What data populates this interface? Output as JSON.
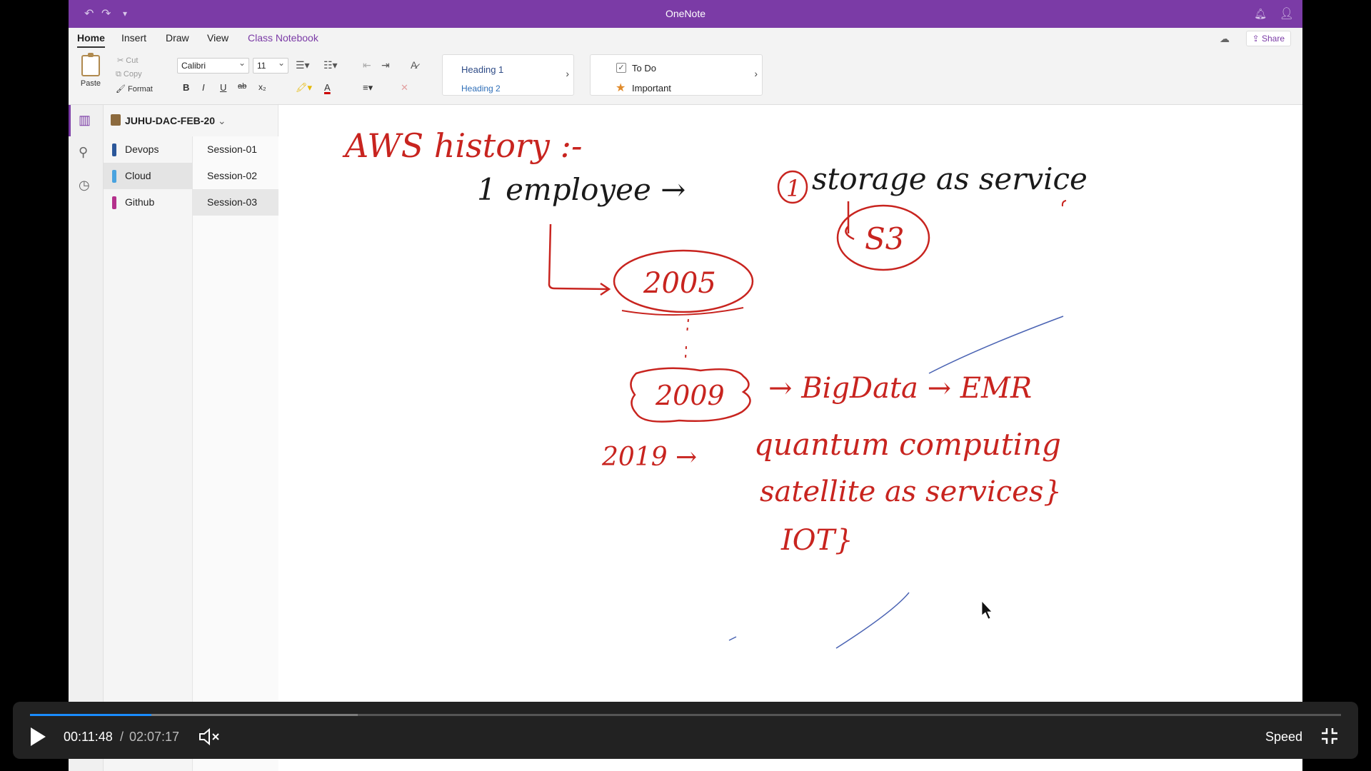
{
  "window": {
    "title": "OneNote"
  },
  "tabs": [
    "Home",
    "Insert",
    "Draw",
    "View",
    "Class Notebook"
  ],
  "share_label": "Share",
  "ribbon": {
    "paste": "Paste",
    "cut": "Cut",
    "copy": "Copy",
    "format": "Format",
    "font_name": "Calibri",
    "font_size": "11",
    "bold": "B",
    "italic": "I",
    "underline": "U",
    "strike": "ab",
    "subscript": "x₂",
    "font_color": "A",
    "heading1": "Heading 1",
    "heading2": "Heading 2",
    "todo": "To Do",
    "important": "Important"
  },
  "notebook": {
    "name": "JUHU-DAC-FEB-20",
    "sections": [
      {
        "label": "Devops",
        "color": "#2b579a"
      },
      {
        "label": "Cloud",
        "color": "#4aa3df"
      },
      {
        "label": "Github",
        "color": "#b4308c"
      }
    ],
    "pages": [
      "Session-01",
      "Session-02",
      "Session-03"
    ],
    "selected_section": "Cloud",
    "selected_page": "Session-03"
  },
  "ink": {
    "heading": "AWS history :-",
    "line1": "1 employee →",
    "circled_num": "1",
    "line1b": "storage as service",
    "s3": "S3",
    "year_2005": "2005",
    "year_2009": "2009",
    "bigdata": "→ BigData → EMR",
    "year_2019": "2019 →",
    "quantum": "quantum computing",
    "satellite": "satellite as services}",
    "iot": "IOT}"
  },
  "player": {
    "current_time": "00:11:48",
    "separator": "/",
    "total_time": "02:07:17",
    "speed_label": "Speed",
    "progress": 0.0927,
    "buffered": 0.25
  },
  "colors": {
    "brand": "#7b3ba6",
    "ink_red": "#c8241f",
    "ink_black": "#1a1a1a",
    "progress_blue": "#1a8cff"
  }
}
